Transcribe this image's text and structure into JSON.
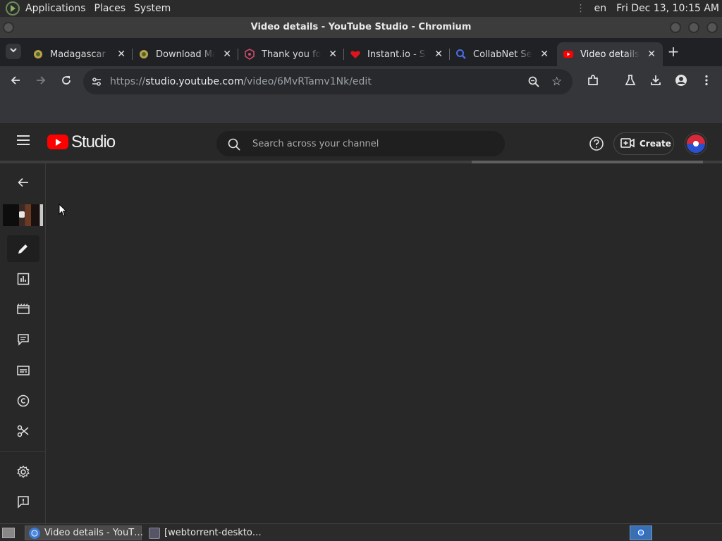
{
  "top_panel": {
    "menus": [
      "Applications",
      "Places",
      "System"
    ],
    "keyboard_layout": "en",
    "datetime": "Fri Dec 13, 10:15 AM"
  },
  "window": {
    "title": "Video details - YouTube Studio - Chromium"
  },
  "tabs": [
    {
      "title": "Madagascar (",
      "favicon": "seal-icon",
      "active": false
    },
    {
      "title": "Download Ma",
      "favicon": "seal-icon",
      "active": false
    },
    {
      "title": "Thank you for",
      "favicon": "shield-icon",
      "active": false
    },
    {
      "title": "Instant.io - Si",
      "favicon": "heart-icon",
      "active": false
    },
    {
      "title": "CollabNet Se",
      "favicon": "magnifier-icon",
      "active": false
    },
    {
      "title": "Video details",
      "favicon": "youtube-icon",
      "active": true
    }
  ],
  "address_bar": {
    "scheme": "https://",
    "host": "studio.youtube.com",
    "path": "/video/6MvRTamv1Nk/edit"
  },
  "studio": {
    "logo_text": "Studio",
    "search_placeholder": "Search across your channel",
    "create_label": "Create"
  },
  "page_loading_progress": "partial",
  "sidebar_items": [
    "back",
    "video-thumbnail",
    "details",
    "analytics",
    "editor",
    "comments",
    "subtitles",
    "copyright",
    "clips",
    "settings",
    "send-feedback"
  ],
  "taskbar": {
    "tasks": [
      {
        "label": "Video details - YouT…",
        "active": true
      },
      {
        "label": "[webtorrent-deskto…",
        "active": false
      }
    ]
  },
  "colors": {
    "youtube_red": "#ff0000",
    "studio_bg": "#282828",
    "chrome_frame": "#202124",
    "chrome_toolbar": "#35363a"
  }
}
